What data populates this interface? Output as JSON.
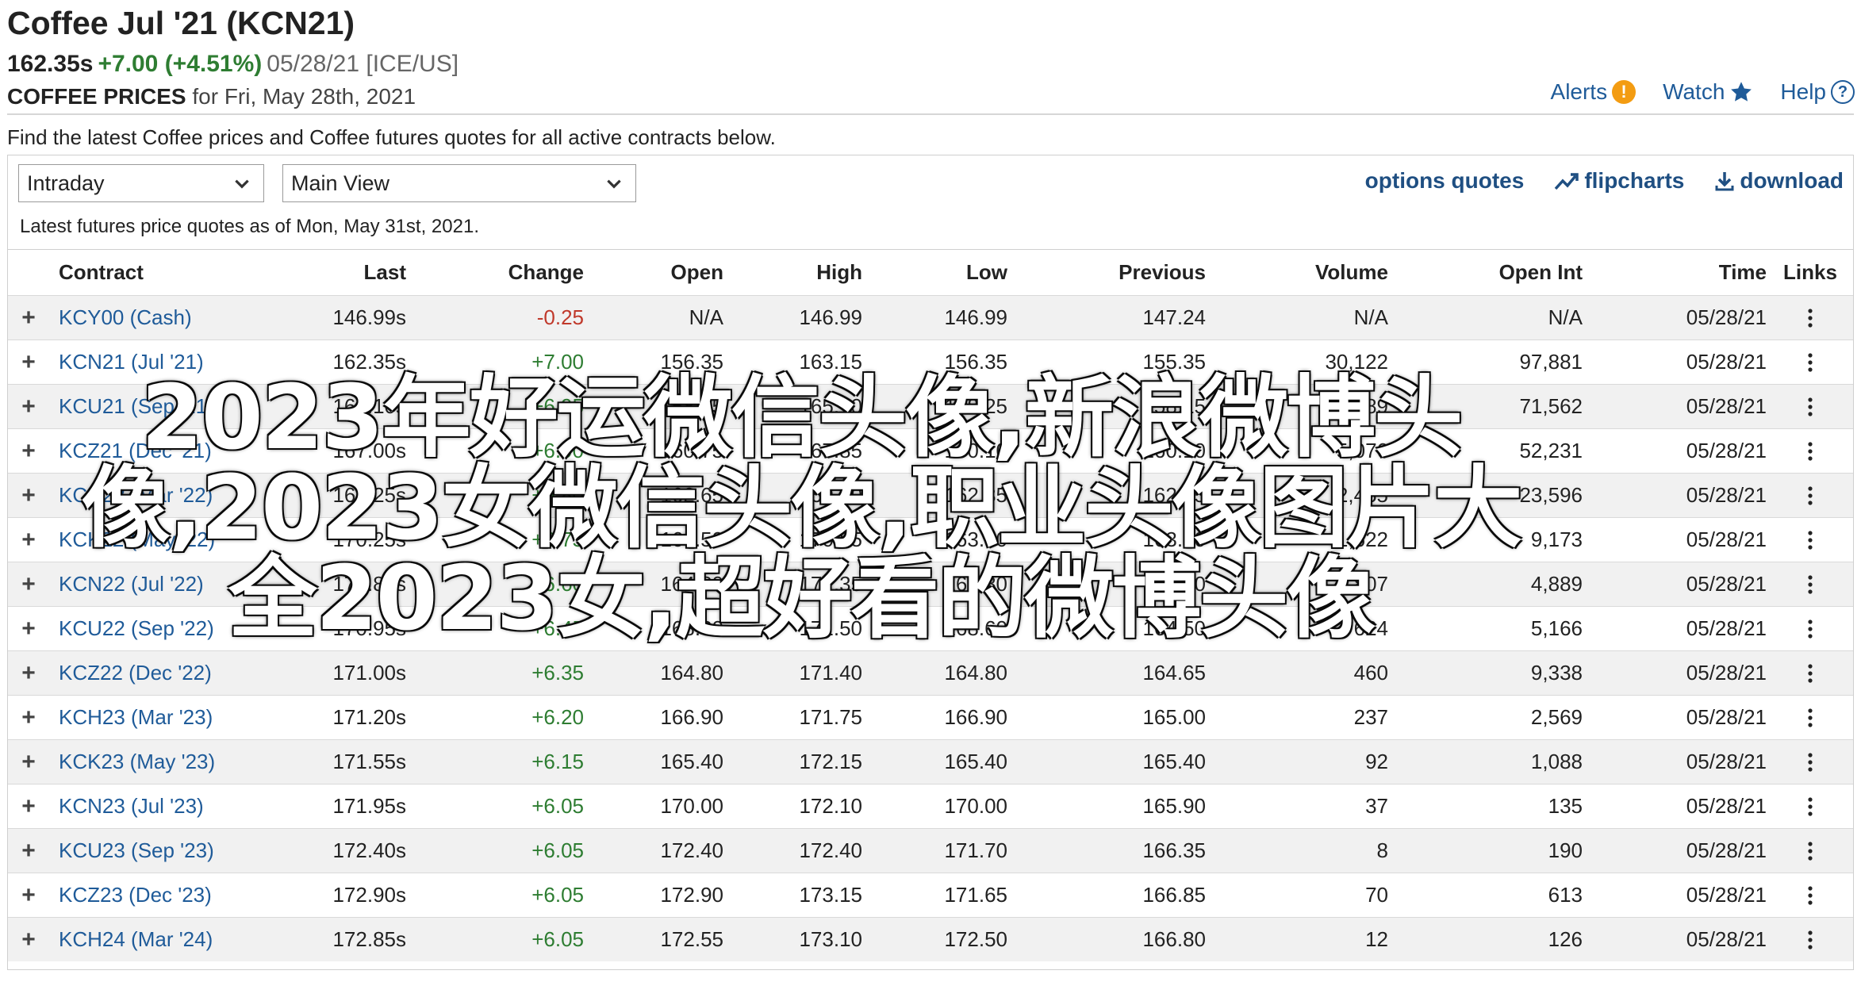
{
  "header": {
    "title": "Coffee Jul '21 (KCN21)",
    "last": "162.35s",
    "change": "+7.00 (+4.51%)",
    "meta": "05/28/21 [ICE/US]",
    "prices_label": "COFFEE PRICES",
    "prices_for": " for Fri, May 28th, 2021"
  },
  "toplinks": {
    "alerts": "Alerts",
    "watch": "Watch",
    "help": "Help"
  },
  "intro": "Find the latest Coffee prices and Coffee futures quotes for all active contracts below.",
  "controls": {
    "period": "Intraday",
    "view": "Main View",
    "options_quotes": "options quotes",
    "flipcharts": "flipcharts",
    "download": "download"
  },
  "asof": "Latest futures price quotes as of Mon, May 31st, 2021.",
  "columns": {
    "contract": "Contract",
    "last": "Last",
    "change": "Change",
    "open": "Open",
    "high": "High",
    "low": "Low",
    "previous": "Previous",
    "volume": "Volume",
    "open_int": "Open Int",
    "time": "Time",
    "links": "Links"
  },
  "rows": [
    {
      "contract": "KCY00 (Cash)",
      "last": "146.99s",
      "change": "-0.25",
      "open": "N/A",
      "high": "146.99",
      "low": "146.99",
      "previous": "147.24",
      "volume": "N/A",
      "open_int": "N/A",
      "time": "05/28/21"
    },
    {
      "contract": "KCN21 (Jul '21)",
      "last": "162.35s",
      "change": "+7.00",
      "open": "156.35",
      "high": "163.15",
      "low": "156.35",
      "previous": "155.35",
      "volume": "30,122",
      "open_int": "97,881",
      "time": "05/28/21"
    },
    {
      "contract": "KCU21 (Sep '21)",
      "last": "165.10s",
      "change": "+6.95",
      "open": "158.25",
      "high": "165.10",
      "low": "158.25",
      "previous": "158.15",
      "volume": "14,389",
      "open_int": "71,562",
      "time": "05/28/21"
    },
    {
      "contract": "KCZ21 (Dec '21)",
      "last": "167.00s",
      "change": "+6.90",
      "open": "160.75",
      "high": "167.85",
      "low": "160.10",
      "previous": "160.10",
      "volume": "5,076",
      "open_int": "52,231",
      "time": "05/28/21"
    },
    {
      "contract": "KCH22 (Mar '22)",
      "last": "169.25s",
      "change": "+6.80",
      "open": "162.65",
      "high": "169.90",
      "low": "162.35",
      "previous": "162.45",
      "volume": "2,455",
      "open_int": "23,596",
      "time": "05/28/21"
    },
    {
      "contract": "KCK22 (May '22)",
      "last": "170.25s",
      "change": "+6.75",
      "open": "163.50",
      "high": "170.85",
      "low": "163.50",
      "previous": "163.50",
      "volume": "1,622",
      "open_int": "9,173",
      "time": "05/28/21"
    },
    {
      "contract": "KCN22 (Jul '22)",
      "last": "170.80s",
      "change": "+6.60",
      "open": "164.80",
      "high": "171.35",
      "low": "164.80",
      "previous": "164.20",
      "volume": "807",
      "open_int": "4,889",
      "time": "05/28/21"
    },
    {
      "contract": "KCU22 (Sep '22)",
      "last": "170.95s",
      "change": "+6.45",
      "open": "168.80",
      "high": "171.50",
      "low": "168.60",
      "previous": "164.50",
      "volume": "624",
      "open_int": "5,166",
      "time": "05/28/21"
    },
    {
      "contract": "KCZ22 (Dec '22)",
      "last": "171.00s",
      "change": "+6.35",
      "open": "164.80",
      "high": "171.40",
      "low": "164.80",
      "previous": "164.65",
      "volume": "460",
      "open_int": "9,338",
      "time": "05/28/21"
    },
    {
      "contract": "KCH23 (Mar '23)",
      "last": "171.20s",
      "change": "+6.20",
      "open": "166.90",
      "high": "171.75",
      "low": "166.90",
      "previous": "165.00",
      "volume": "237",
      "open_int": "2,569",
      "time": "05/28/21"
    },
    {
      "contract": "KCK23 (May '23)",
      "last": "171.55s",
      "change": "+6.15",
      "open": "165.40",
      "high": "172.15",
      "low": "165.40",
      "previous": "165.40",
      "volume": "92",
      "open_int": "1,088",
      "time": "05/28/21"
    },
    {
      "contract": "KCN23 (Jul '23)",
      "last": "171.95s",
      "change": "+6.05",
      "open": "170.00",
      "high": "172.10",
      "low": "170.00",
      "previous": "165.90",
      "volume": "37",
      "open_int": "135",
      "time": "05/28/21"
    },
    {
      "contract": "KCU23 (Sep '23)",
      "last": "172.40s",
      "change": "+6.05",
      "open": "172.40",
      "high": "172.40",
      "low": "171.70",
      "previous": "166.35",
      "volume": "8",
      "open_int": "190",
      "time": "05/28/21"
    },
    {
      "contract": "KCZ23 (Dec '23)",
      "last": "172.90s",
      "change": "+6.05",
      "open": "172.90",
      "high": "173.15",
      "low": "171.65",
      "previous": "166.85",
      "volume": "70",
      "open_int": "613",
      "time": "05/28/21"
    },
    {
      "contract": "KCH24 (Mar '24)",
      "last": "172.85s",
      "change": "+6.05",
      "open": "172.55",
      "high": "173.10",
      "low": "172.50",
      "previous": "166.80",
      "volume": "12",
      "open_int": "126",
      "time": "05/28/21"
    }
  ],
  "watermark": "2023年好运微信头像,新浪微博头像,2023女微信头像,职业头像图片大全2023女,超好看的微博头像",
  "colors": {
    "link": "#1f5b99",
    "positive": "#2e7d32",
    "negative": "#c0392b",
    "row_alt": "#f1f1f1",
    "alert": "#f39c12"
  }
}
